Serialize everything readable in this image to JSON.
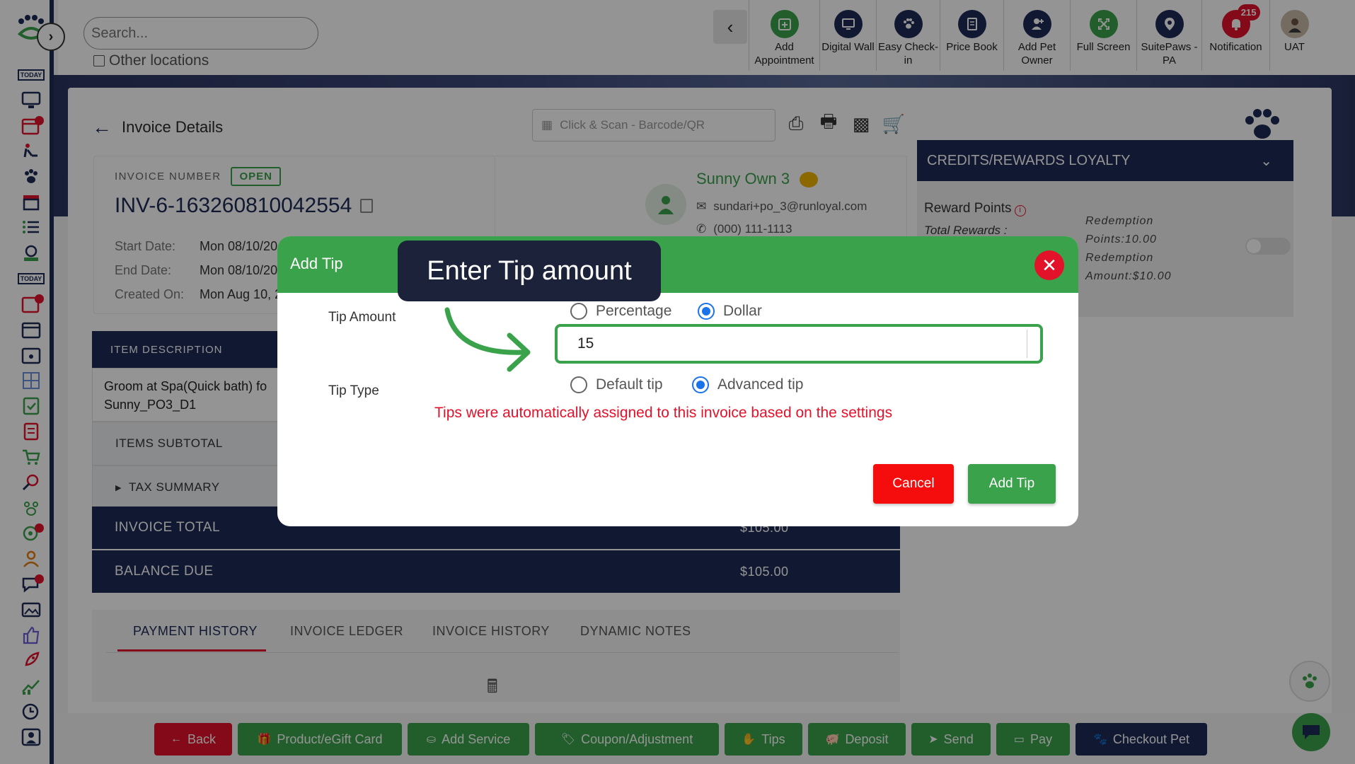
{
  "topbar": {
    "search_placeholder": "Search...",
    "other_locations": "Other locations",
    "tools": [
      {
        "label": "Add Appointment",
        "icon": "calendar-plus-icon",
        "color": "#3aa24a"
      },
      {
        "label": "Digital Wall",
        "icon": "monitor-icon",
        "color": "#1d2a57"
      },
      {
        "label": "Easy Check-in",
        "icon": "paw-icon",
        "color": "#1d2a57"
      },
      {
        "label": "Price Book",
        "icon": "book-icon",
        "color": "#1d2a57"
      },
      {
        "label": "Add Pet Owner",
        "icon": "user-plus-icon",
        "color": "#1d2a57"
      },
      {
        "label": "Full Screen",
        "icon": "expand-icon",
        "color": "#3aa24a"
      },
      {
        "label": "SuitePaws - PA",
        "icon": "location-pin-icon",
        "color": "#1d2a57"
      },
      {
        "label": "Notification",
        "icon": "bell-icon",
        "color": "#e3122b",
        "count": "215"
      },
      {
        "label": "UAT",
        "icon": "avatar",
        "color": "#555555"
      }
    ]
  },
  "invoice": {
    "page_title": "Invoice Details",
    "scan_placeholder": "Click & Scan - Barcode/QR",
    "number_label": "INVOICE NUMBER",
    "status": "OPEN",
    "number": "INV-6-163260810042554",
    "start_label": "Start Date:",
    "start_value": "Mon 08/10/20",
    "end_label": "End Date:",
    "end_value": "Mon 08/10/20",
    "created_label": "Created On:",
    "created_value": "Mon Aug 10, 2"
  },
  "customer": {
    "name": "Sunny Own 3",
    "email": "sundari+po_3@runloyal.com",
    "phone": "(000) 111-1113"
  },
  "loyalty": {
    "title": "CREDITS/REWARDS LOYALTY",
    "reward_points": "Reward Points",
    "total_rewards": "Total Rewards :",
    "redemption_line1": "Redemption",
    "redemption_line2": "Points:10.00",
    "redemption_line3": "Redemption",
    "redemption_line4": "Amount:$10.00"
  },
  "items": {
    "header": "ITEM DESCRIPTION",
    "row_line1": "Groom at Spa(Quick bath) fo",
    "row_line2": "Sunny_PO3_D1",
    "subtotal_label": "ITEMS SUBTOTAL",
    "tax_label": "TAX SUMMARY",
    "total_label": "INVOICE TOTAL",
    "total_value": "$105.00",
    "balance_label": "BALANCE DUE",
    "balance_value": "$105.00"
  },
  "tabs": [
    "PAYMENT HISTORY",
    "INVOICE LEDGER",
    "INVOICE HISTORY",
    "DYNAMIC NOTES"
  ],
  "bottom_buttons": {
    "back": "Back",
    "product": "Product/eGift Card",
    "service": "Add Service",
    "coupon": "Coupon/Adjustment",
    "tips": "Tips",
    "deposit": "Deposit",
    "send": "Send",
    "pay": "Pay",
    "checkout": "Checkout Pet"
  },
  "modal": {
    "title": "Add Tip",
    "tip_amount_label": "Tip Amount",
    "opt_percentage": "Percentage",
    "opt_dollar": "Dollar",
    "tip_value": "15",
    "tip_type_label": "Tip Type",
    "opt_default": "Default tip",
    "opt_advanced": "Advanced tip",
    "auto_message": "Tips were automatically assigned to this invoice based on the settings",
    "cancel": "Cancel",
    "add": "Add Tip"
  },
  "callout": {
    "text": "Enter Tip amount"
  },
  "colors": {
    "navy": "#1d2a57",
    "green": "#3aa24a",
    "red": "#e3122b"
  }
}
